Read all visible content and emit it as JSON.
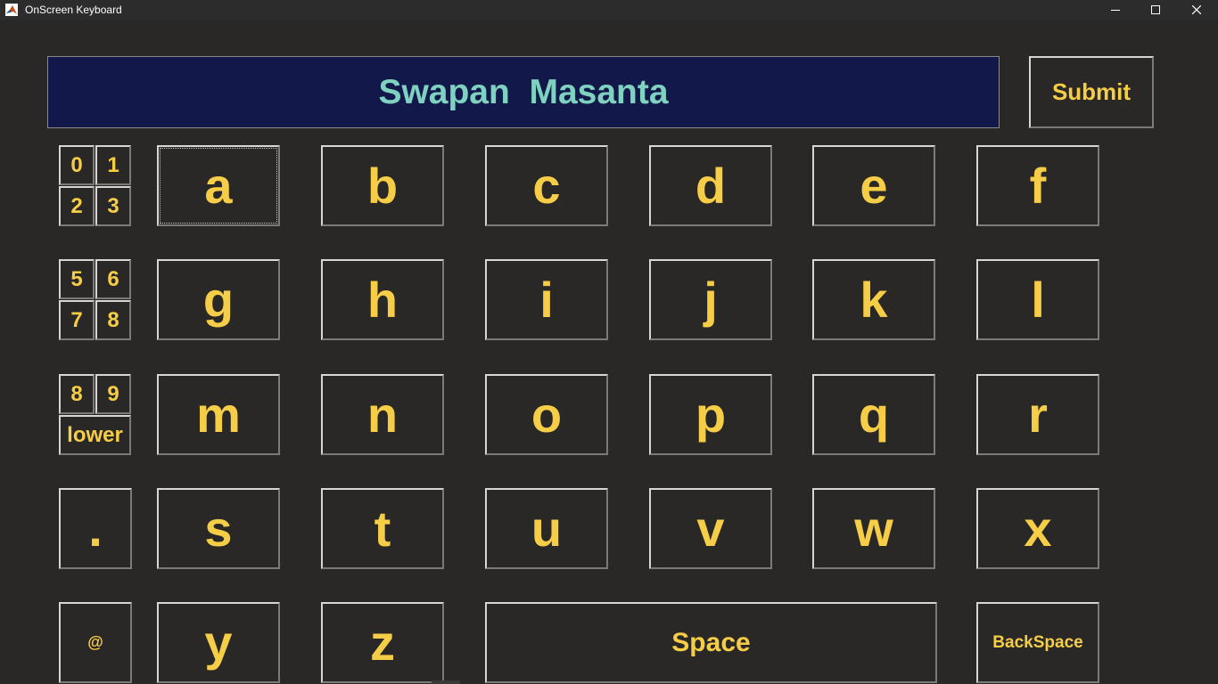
{
  "window": {
    "title": "OnScreen Keyboard",
    "icon": "matlab-icon",
    "controls": [
      "minimize",
      "maximize",
      "close"
    ]
  },
  "display": {
    "text": "Swapan  Masanta"
  },
  "submit": {
    "label": "Submit"
  },
  "numpad": {
    "group1": [
      "0",
      "1",
      "2",
      "3"
    ],
    "group2": [
      "5",
      "6",
      "7",
      "8"
    ],
    "group3": [
      "8",
      "9"
    ],
    "lower_label": "lower",
    "dot_label": ".",
    "at_label": "@"
  },
  "letters": {
    "row1": [
      "a",
      "b",
      "c",
      "d",
      "e",
      "f"
    ],
    "row2": [
      "g",
      "h",
      "i",
      "j",
      "k",
      "l"
    ],
    "row3": [
      "m",
      "n",
      "o",
      "p",
      "q",
      "r"
    ],
    "row4": [
      "s",
      "t",
      "u",
      "v",
      "w",
      "x"
    ],
    "row5": [
      "y",
      "z"
    ]
  },
  "special": {
    "space_label": "Space",
    "backspace_label": "BackSpace"
  },
  "colors": {
    "background": "#292827",
    "display_background": "#12184a",
    "display_text": "#7fd1c0",
    "key_text": "#f6cd46"
  }
}
